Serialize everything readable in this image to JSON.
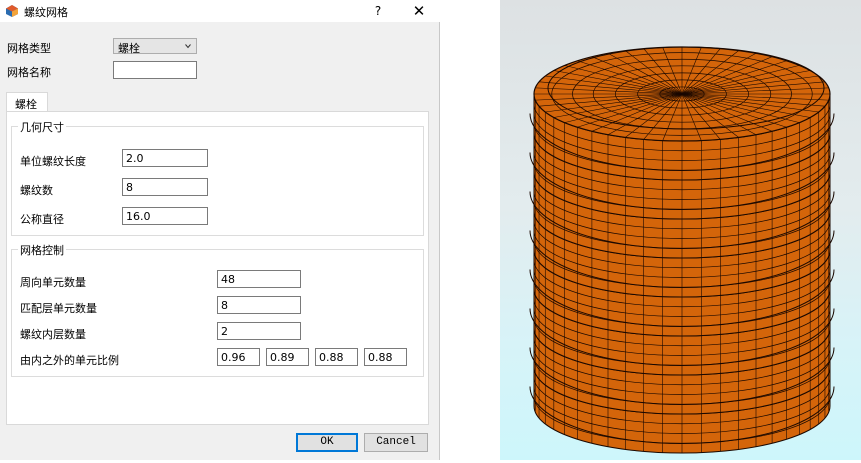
{
  "window": {
    "title": "螺纹网格",
    "help_glyph": "?",
    "close_glyph": "✕"
  },
  "form": {
    "mesh_type_label": "网格类型",
    "mesh_type_value": "螺栓",
    "mesh_name_label": "网格名称",
    "mesh_name_value": ""
  },
  "tabs": [
    {
      "label": "螺栓",
      "active": true
    }
  ],
  "geometry": {
    "title": "几何尺寸",
    "fields": [
      {
        "label": "单位螺纹长度",
        "value": "2.0"
      },
      {
        "label": "螺纹数",
        "value": "8"
      },
      {
        "label": "公称直径",
        "value": "16.0"
      }
    ]
  },
  "mesh_control": {
    "title": "网格控制",
    "fields": [
      {
        "label": "周向单元数量",
        "value": "48"
      },
      {
        "label": "匹配层单元数量",
        "value": "8"
      },
      {
        "label": "螺纹内层数量",
        "value": "2"
      }
    ],
    "ratio_label": "由内之外的单元比例",
    "ratios": [
      "0.96",
      "0.89",
      "0.88",
      "0.88"
    ]
  },
  "buttons": {
    "ok": "OK",
    "cancel": "Cancel"
  },
  "viewport": {
    "model": "threaded bolt surface mesh",
    "mesh_color": "#d4650a",
    "edge_color": "#1a0800",
    "background_top": "#dde1e3",
    "background_bottom": "#cdf6fb",
    "thread_count": 8,
    "circumferential_elements": 48
  }
}
